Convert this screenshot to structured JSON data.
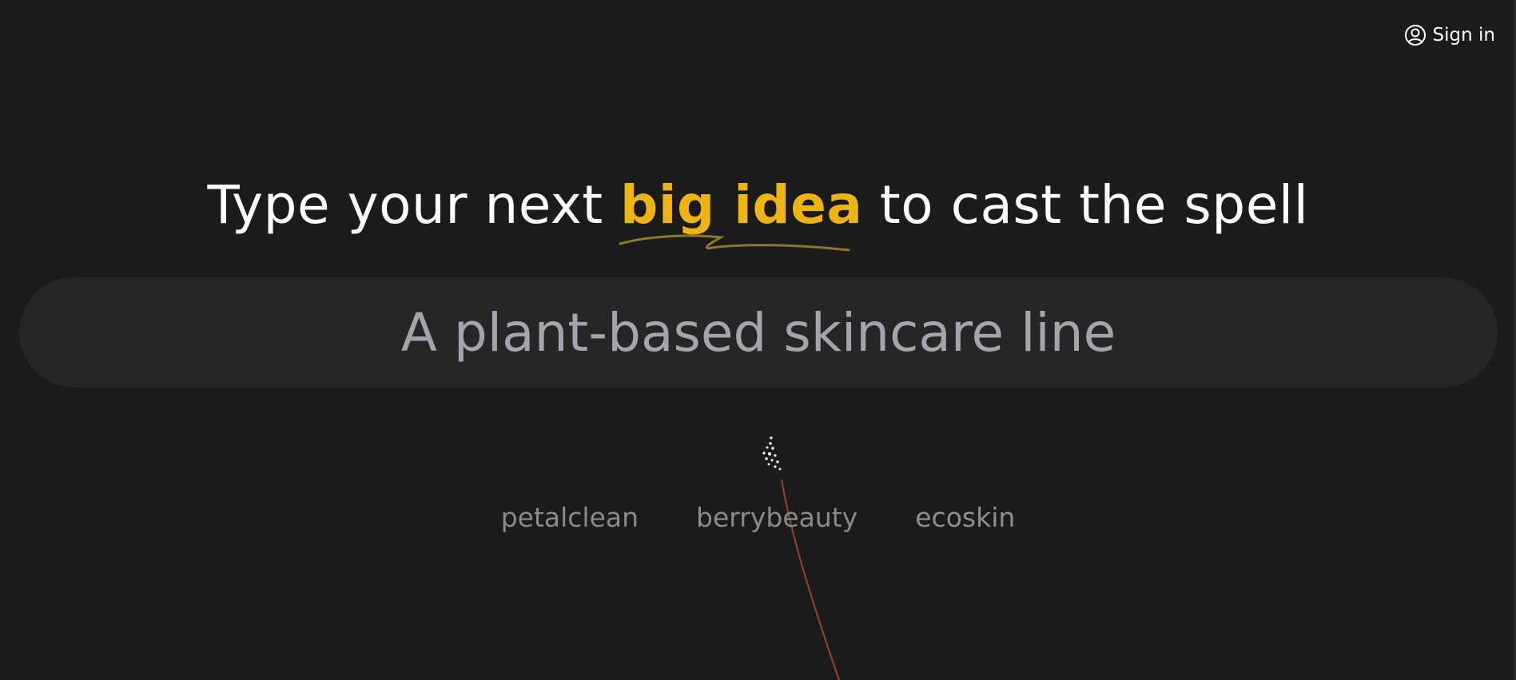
{
  "header": {
    "signin_label": "Sign in",
    "signin_icon": "user-circle-icon"
  },
  "hero": {
    "headline_prefix": "Type your next ",
    "headline_highlight": "big idea",
    "headline_suffix": " to cast the spell",
    "highlight_color": "#ecb414"
  },
  "search": {
    "value": "A plant-based skincare line",
    "placeholder": "A plant-based skincare line"
  },
  "suggestions": [
    {
      "label": "petalclean"
    },
    {
      "label": "berrybeauty"
    },
    {
      "label": "ecoskin"
    }
  ],
  "colors": {
    "background": "#1c1b1b",
    "search_bg": "#272626",
    "text": "#ffffff",
    "muted": "#a5a4ad"
  }
}
